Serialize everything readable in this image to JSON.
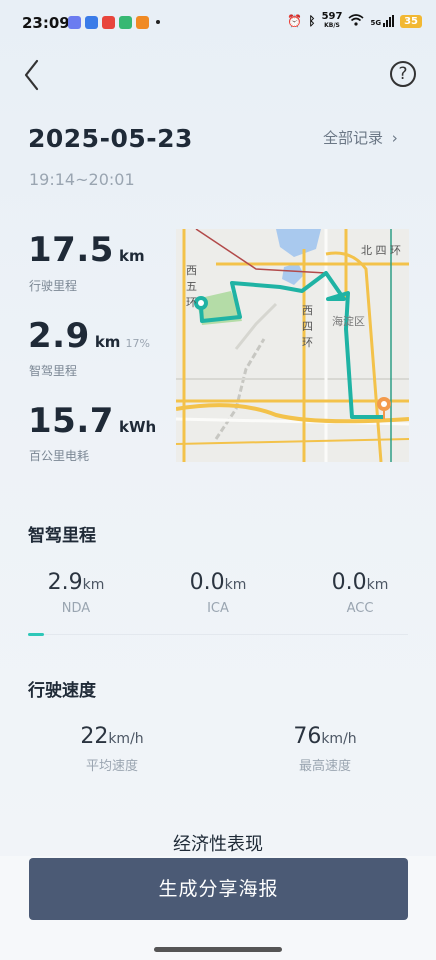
{
  "status_bar": {
    "time": "23:09",
    "net_speed_value": "597",
    "net_speed_unit": "KB/S",
    "signal_label": "5G",
    "battery": "35"
  },
  "header": {
    "date": "2025-05-23",
    "all_records": "全部记录",
    "time_range": "19:14~20:01"
  },
  "stats": {
    "distance": {
      "value": "17.5",
      "unit": "km",
      "label": "行驶里程"
    },
    "smart_distance": {
      "value": "2.9",
      "unit": "km",
      "percent": "17%",
      "label": "智驾里程"
    },
    "energy": {
      "value": "15.7",
      "unit": "kWh",
      "label": "百公里电耗"
    }
  },
  "map": {
    "labels": {
      "north4": "北 四 环",
      "west5": "西五环",
      "west4": "西四环",
      "haidian": "海淀区"
    }
  },
  "smart_driving": {
    "title": "智驾里程",
    "items": [
      {
        "value": "2.9",
        "unit": "km",
        "label": "NDA"
      },
      {
        "value": "0.0",
        "unit": "km",
        "label": "ICA"
      },
      {
        "value": "0.0",
        "unit": "km",
        "label": "ACC"
      }
    ]
  },
  "speed": {
    "title": "行驶速度",
    "avg": {
      "value": "22",
      "unit": "km/h",
      "label": "平均速度"
    },
    "max": {
      "value": "76",
      "unit": "km/h",
      "label": "最高速度"
    }
  },
  "economy": {
    "title": "经济性表现"
  },
  "share_button": "生成分享海报",
  "colors": {
    "accent": "#2ec7b8",
    "button": "#4b5a75",
    "route": "#1fb3a4",
    "destination": "#f39a4c"
  }
}
